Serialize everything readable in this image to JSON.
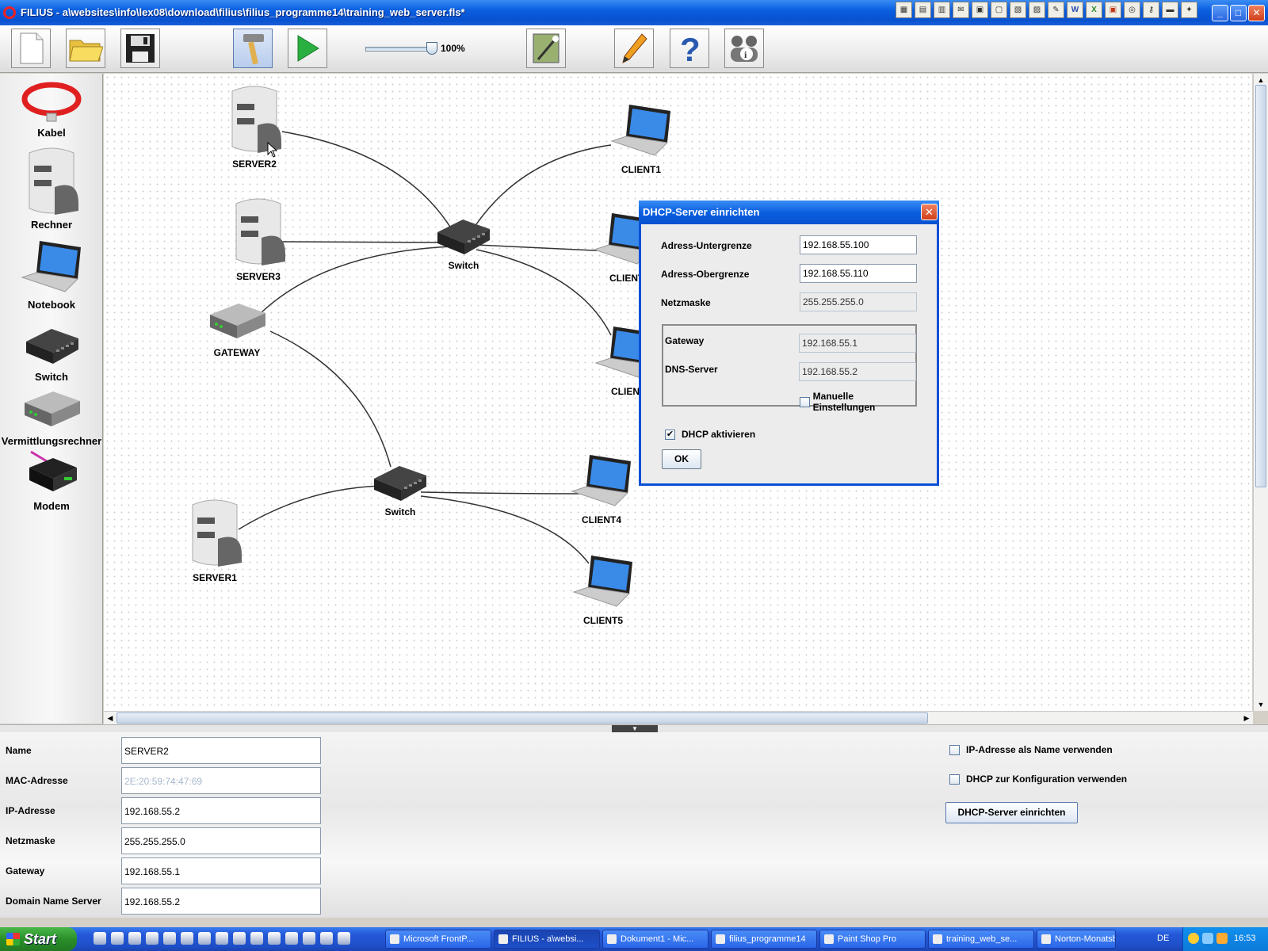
{
  "window": {
    "title": "FILIUS - a\\websites\\info\\lex08\\download\\filius\\filius_programme14\\training_web_server.fls*"
  },
  "toolbar": {
    "zoom_label": "100%"
  },
  "palette": {
    "items": [
      {
        "label": "Kabel"
      },
      {
        "label": "Rechner"
      },
      {
        "label": "Notebook"
      },
      {
        "label": "Switch"
      },
      {
        "label": "Vermittlungsrechner"
      },
      {
        "label": "Modem"
      }
    ]
  },
  "network": {
    "nodes": {
      "server2": "SERVER2",
      "server3": "SERVER3",
      "gateway": "GATEWAY",
      "server1": "SERVER1",
      "switch1": "Switch",
      "switch2": "Switch",
      "client1": "CLIENT1",
      "client2": "CLIENT",
      "client3": "CLIENT",
      "client4": "CLIENT4",
      "client5": "CLIENT5"
    }
  },
  "properties": {
    "name_label": "Name",
    "name_value": "SERVER2",
    "mac_label": "MAC-Adresse",
    "mac_value": "2E:20:59:74:47:69",
    "ip_label": "IP-Adresse",
    "ip_value": "192.168.55.2",
    "mask_label": "Netzmaske",
    "mask_value": "255.255.255.0",
    "gateway_label": "Gateway",
    "gateway_value": "192.168.55.1",
    "dns_label": "Domain Name Server",
    "dns_value": "192.168.55.2",
    "ip_as_name_label": "IP-Adresse als Name verwenden",
    "use_dhcp_label": "DHCP zur Konfiguration verwenden",
    "dhcp_setup_button": "DHCP-Server einrichten"
  },
  "dialog": {
    "title": "DHCP-Server einrichten",
    "lower_label": "Adress-Untergrenze",
    "lower_value": "192.168.55.100",
    "upper_label": "Adress-Obergrenze",
    "upper_value": "192.168.55.110",
    "mask_label": "Netzmaske",
    "mask_value": "255.255.255.0",
    "gateway_label": "Gateway",
    "gateway_value": "192.168.55.1",
    "dns_label": "DNS-Server",
    "dns_value": "192.168.55.2",
    "manual_label": "Manuelle Einstellungen",
    "dhcp_enable_label": "DHCP aktivieren",
    "ok_label": "OK"
  },
  "taskbar": {
    "start_label": "Start",
    "tasks": [
      {
        "label": "Microsoft FrontP..."
      },
      {
        "label": "FILIUS - a\\websi..."
      },
      {
        "label": "Dokument1 - Mic..."
      },
      {
        "label": "filius_programme14"
      },
      {
        "label": "Paint Shop Pro"
      },
      {
        "label": "training_web_se..."
      },
      {
        "label": "Norton-Monatsb..."
      }
    ],
    "language": "DE",
    "clock": "16:53"
  }
}
